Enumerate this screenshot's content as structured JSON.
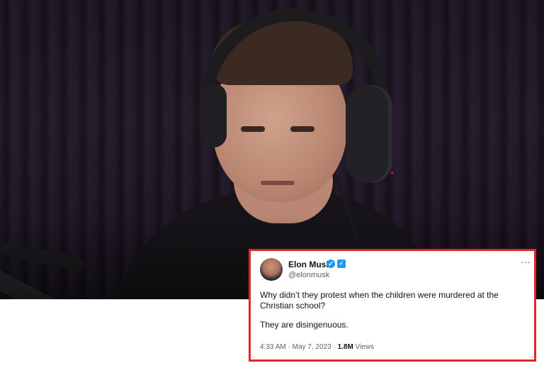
{
  "tweet": {
    "author_name": "Elon Musk",
    "author_handle": "@elonmusk",
    "verified_icon": "verified-check-icon",
    "badge_icon": "twitter-badge-icon",
    "more_icon": "more-options-icon",
    "more_glyph": "···",
    "text_line1": "Why didn’t they protest when the children were murdered at the Christian school?",
    "text_line2": "They are disingenuous.",
    "time": "4:33 AM",
    "date": "May 7, 2023",
    "separator": "·",
    "views_count": "1.8M",
    "views_label": "Views",
    "border_color": "#e3242b",
    "accent_color": "#1d9bf0"
  }
}
